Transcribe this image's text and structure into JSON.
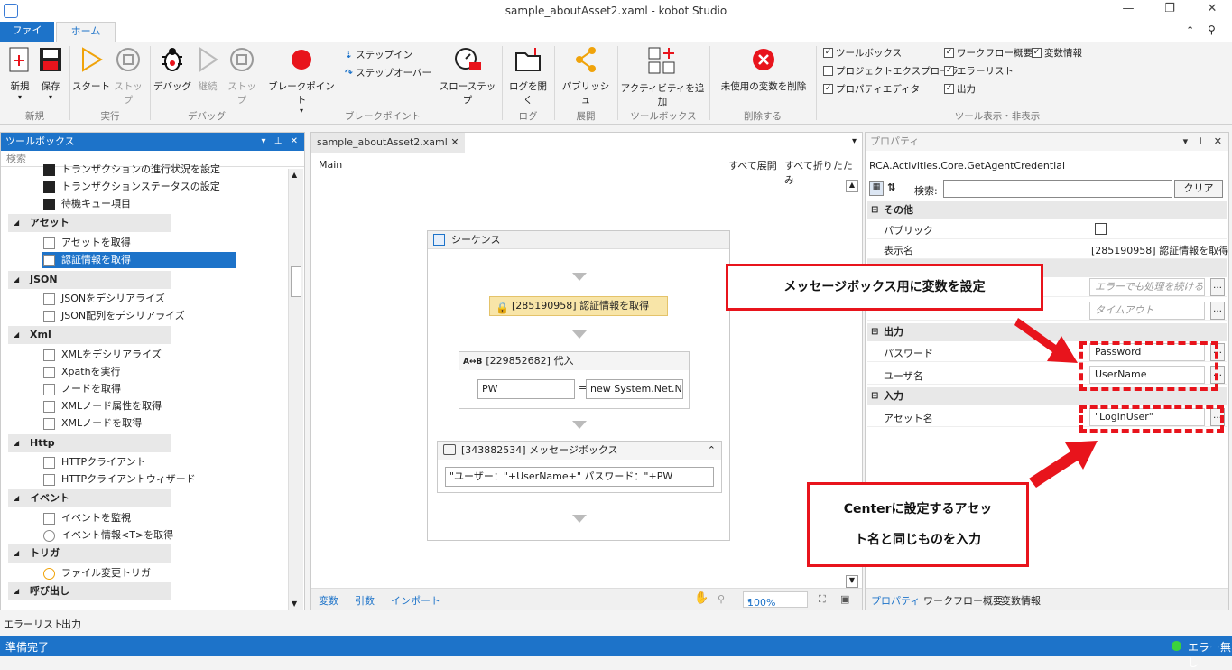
{
  "window": {
    "title": "sample_aboutAsset2.xaml - kobot Studio"
  },
  "menu": {
    "file": "ファイル",
    "home": "ホーム"
  },
  "ribbon": {
    "new": "新規",
    "save": "保存",
    "start": "スタート",
    "stop": "ストップ",
    "debug": "デバッグ",
    "continue": "継続",
    "stop2": "ストップ",
    "breakpoint": "ブレークポイント",
    "step_in": "ステップイン",
    "step_over": "ステップオーバー",
    "slow_step": "スローステップ",
    "open_log": "ログを開く",
    "publish": "パブリッシュ",
    "add_activity": "アクティビティを追加",
    "delete_unused": "未使用の変数を削除",
    "groups": {
      "new": "新規",
      "run": "実行",
      "debug": "デバッグ",
      "breakpoint": "ブレークポイント",
      "log": "ログ",
      "deploy": "展開",
      "toolbox": "ツールボックス",
      "delete": "削除する",
      "toolshow": "ツール表示・非表示"
    },
    "checks": {
      "toolbox": "ツールボックス",
      "workflow_overview": "ワークフロー概要",
      "variables": "変数情報",
      "project_explorer": "プロジェクトエクスプローラ",
      "error_list": "エラーリスト",
      "property_editor": "プロパティエディタ",
      "output": "出力"
    }
  },
  "toolbox": {
    "title": "ツールボックス",
    "search": "検索",
    "items": [
      "トランザクションの進行状況を設定",
      "トランザクションステータスの設定",
      "待機キュー項目"
    ],
    "cats": {
      "asset": "アセット",
      "json": "JSON",
      "xml": "Xml",
      "http": "Http",
      "event": "イベント",
      "trigger": "トリガ",
      "call": "呼び出し"
    },
    "asset_items": [
      "アセットを取得",
      "認証情報を取得"
    ],
    "json_items": [
      "JSONをデシリアライズ",
      "JSON配列をデシリアライズ"
    ],
    "xml_items": [
      "XMLをデシリアライズ",
      "Xpathを実行",
      "ノードを取得",
      "XMLノード属性を取得",
      "XMLノードを取得"
    ],
    "http_items": [
      "HTTPクライアント",
      "HTTPクライアントウィザード"
    ],
    "event_items": [
      "イベントを監視",
      "イベント情報<T>を取得"
    ],
    "trigger_items": [
      "ファイル変更トリガ"
    ]
  },
  "designer": {
    "tab": "sample_aboutAsset2.xaml",
    "crumb": "Main",
    "expand_all": "すべて展開",
    "collapse_all": "すべて折りたたみ",
    "sequence": "シーケンス",
    "credential": "[285190958] 認証情報を取得",
    "assign": "[229852682] 代入",
    "assign_to": "PW",
    "assign_eq": "=",
    "assign_value": "new System.Net.Ne",
    "msgbox": "[343882534] メッセージボックス",
    "msgbox_text": "\"ユーザー：\"+UserName+\" パスワード：\"+PW",
    "bottom": {
      "vars": "変数",
      "args": "引数",
      "imports": "インポート",
      "zoom": "100%"
    }
  },
  "props": {
    "title": "プロパティ",
    "type": "RCA.Activities.Core.GetAgentCredential",
    "search_label": "検索:",
    "clear": "クリア",
    "cat_other": "その他",
    "public": "パブリック",
    "display_name": "表示名",
    "display_value": "[285190958] 認証情報を取得",
    "continue_on_error": "エラーでも処理を続ける",
    "timeout": "タイムアウト",
    "cat_output": "出力",
    "password": "パスワード",
    "password_value": "Password",
    "username": "ユーザ名",
    "username_value": "UserName",
    "cat_input": "入力",
    "asset_name": "アセット名",
    "asset_value": "\"LoginUser\"",
    "tabs": {
      "props": "プロパティ",
      "overview": "ワークフロー概要",
      "vars": "変数情報"
    }
  },
  "out": {
    "errors": "エラーリスト",
    "output": "出力"
  },
  "status": {
    "ready": "準備完了",
    "no_error": "エラー無し"
  },
  "callouts": {
    "top": "メッセージボックス用に変数を設定",
    "bottom_line1": "Centerに設定するアセッ",
    "bottom_line2": "ト名と同じものを入力"
  },
  "colors": {
    "accent": "#1d73c9",
    "callout": "#e8141c"
  }
}
